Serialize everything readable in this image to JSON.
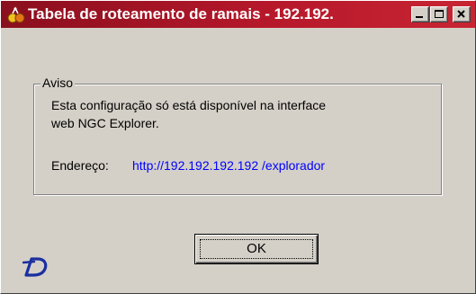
{
  "window": {
    "title": "Tabela de roteamento de ramais - 192.192.",
    "icons": {
      "app": "app-icon",
      "minimize": "minimize-icon",
      "maximize": "maximize-icon",
      "close": "close-icon",
      "logo": "brand-logo-d"
    }
  },
  "group": {
    "legend": "Aviso",
    "message_line1": "Esta configuração só está disponível na interface",
    "message_line2": "web NGC Explorer.",
    "address_label": "Endereço:",
    "address_link": "http://192.192.192.192 /explorador"
  },
  "buttons": {
    "ok_label": "OK"
  },
  "colors": {
    "titlebar_start": "#8a0f1e",
    "titlebar_end": "#c82533",
    "dialog_bg": "#d4d0c8",
    "link": "#0000ff",
    "logo": "#1a2fa0"
  }
}
